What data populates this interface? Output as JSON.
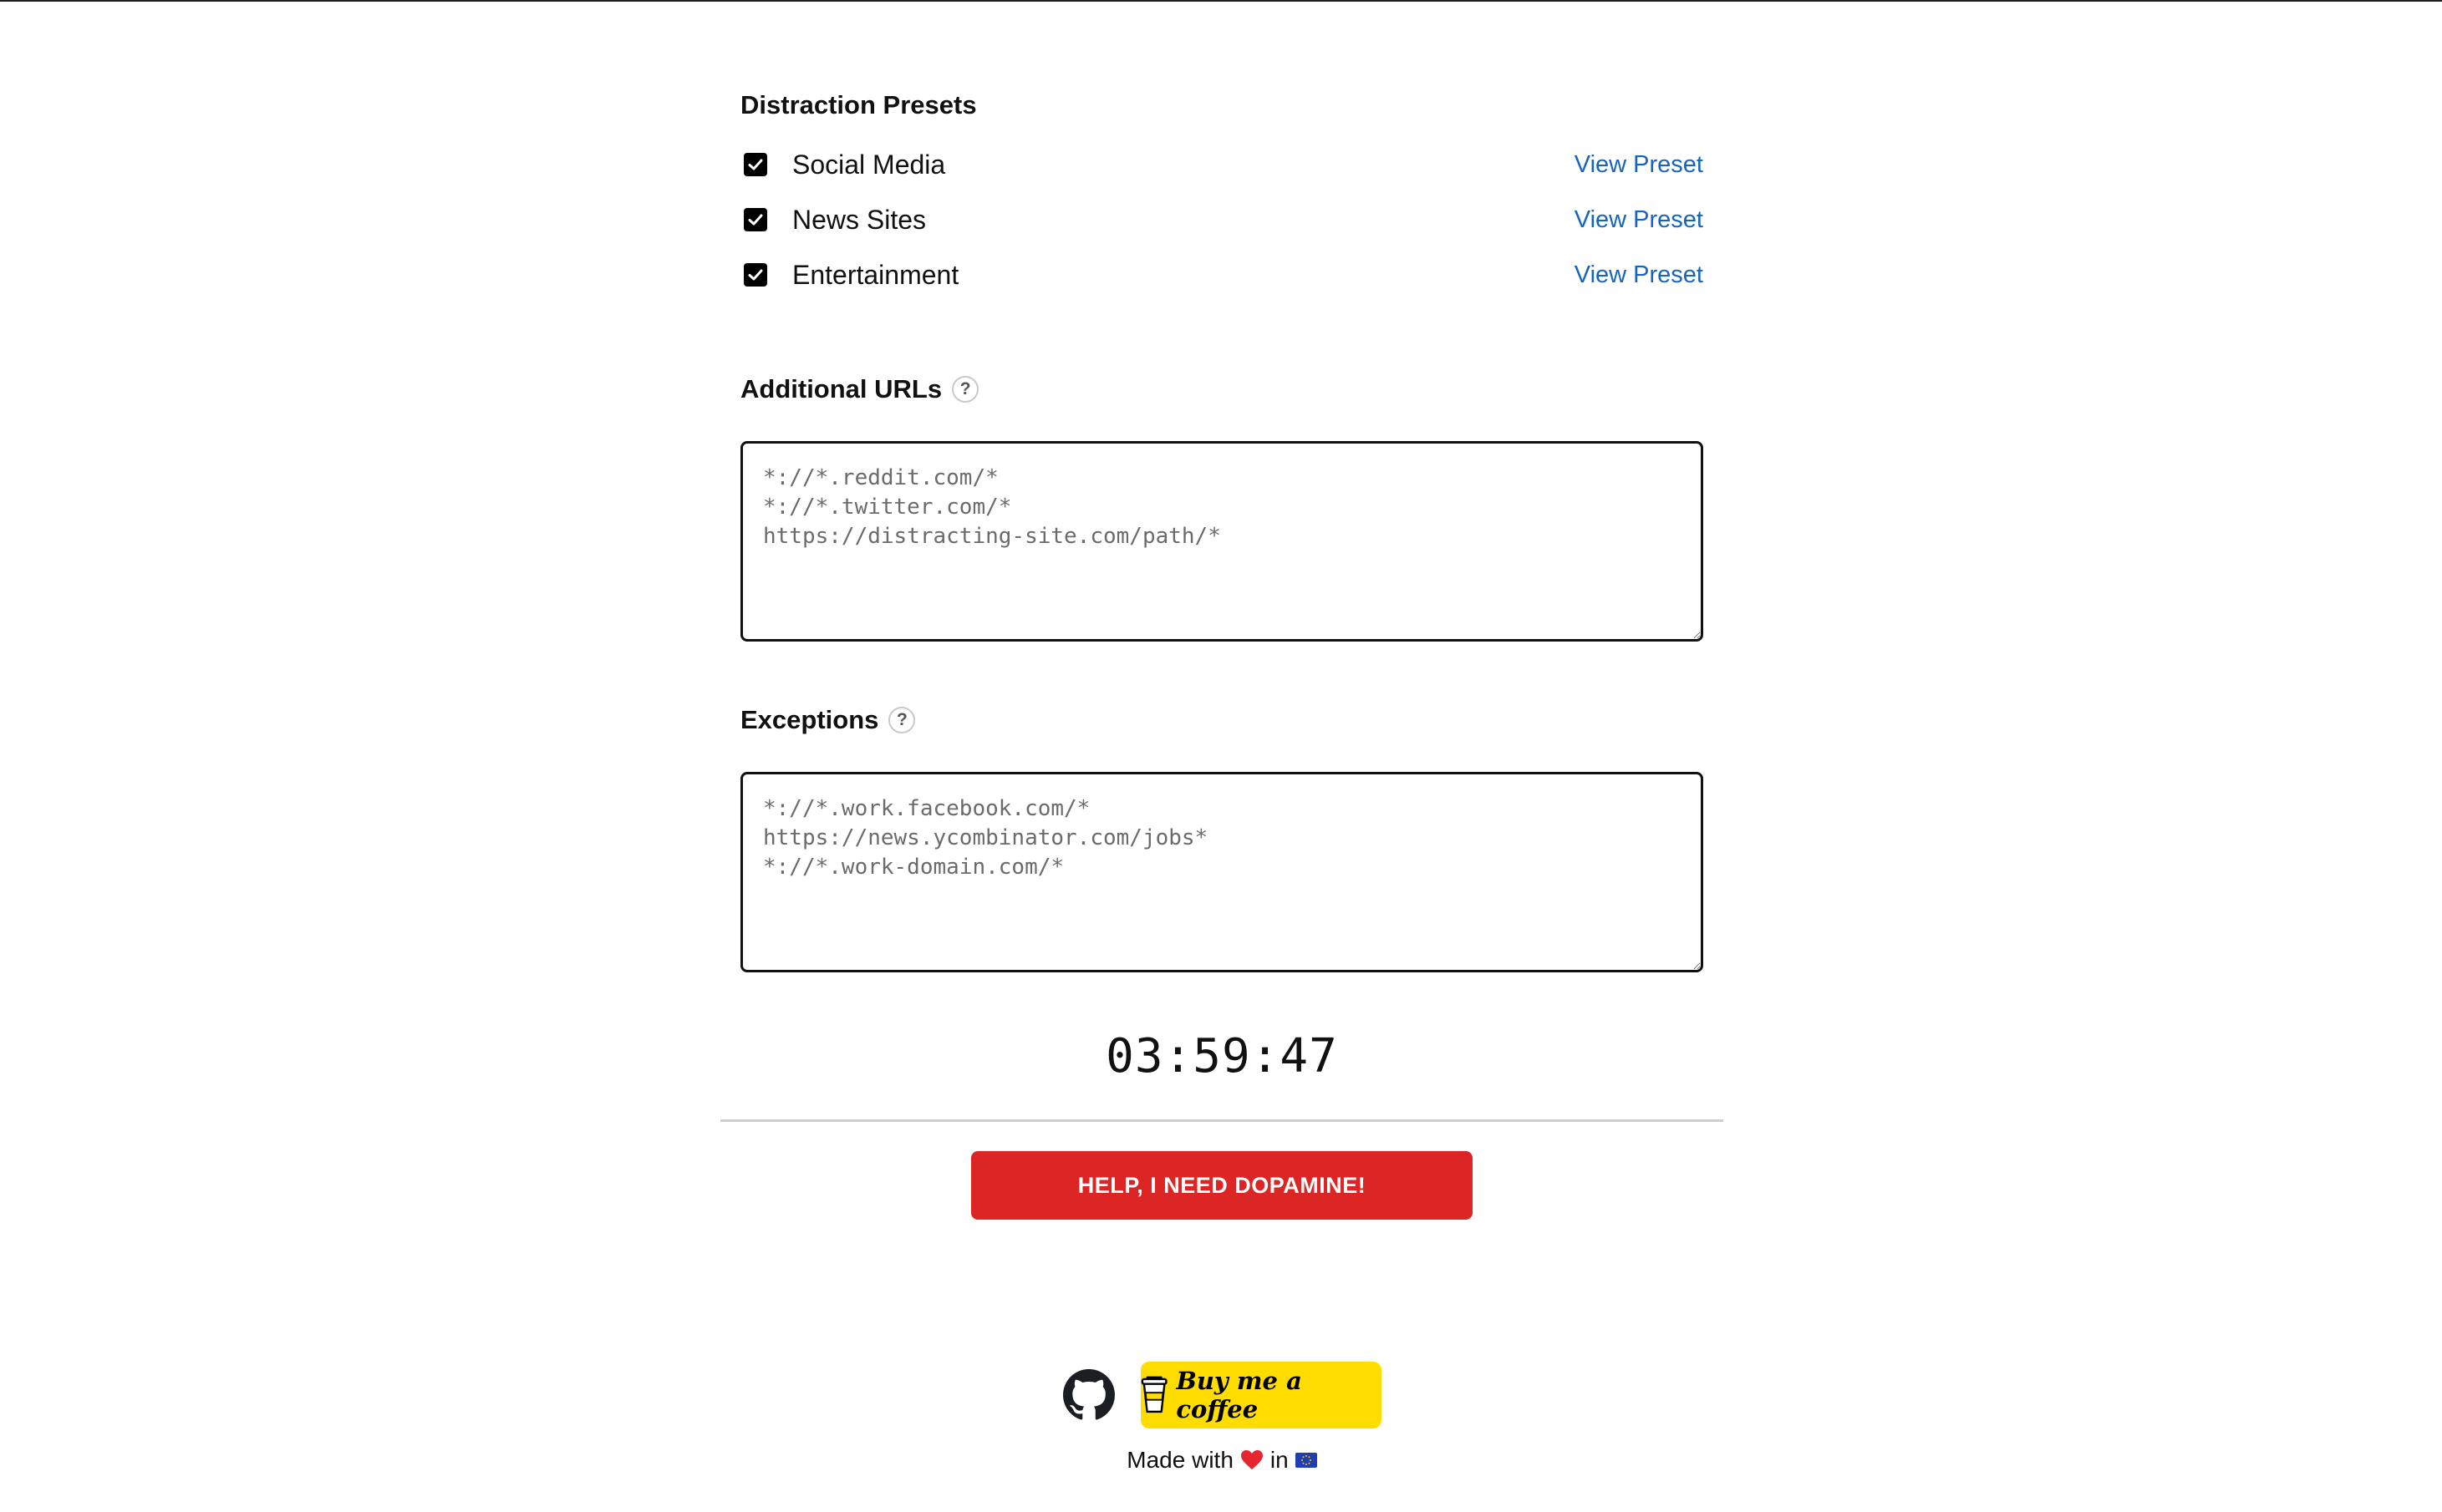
{
  "presets": {
    "title": "Distraction Presets",
    "items": [
      {
        "label": "Social Media",
        "checked": true,
        "link": "View Preset"
      },
      {
        "label": "News Sites",
        "checked": true,
        "link": "View Preset"
      },
      {
        "label": "Entertainment",
        "checked": true,
        "link": "View Preset"
      }
    ]
  },
  "additional_urls": {
    "title": "Additional URLs",
    "help": "?",
    "placeholder": "*://*.reddit.com/*\n*://*.twitter.com/*\nhttps://distracting-site.com/path/*"
  },
  "exceptions": {
    "title": "Exceptions",
    "help": "?",
    "placeholder": "*://*.work.facebook.com/*\nhttps://news.ycombinator.com/jobs*\n*://*.work-domain.com/*"
  },
  "timer": "03:59:47",
  "dopamine_button": "HELP, I NEED DOPAMINE!",
  "footer": {
    "coffee_label": "Buy me a coffee",
    "made_with_prefix": "Made with",
    "made_with_in": "in",
    "icons": [
      "github-icon",
      "coffee-cup-icon",
      "heart-icon",
      "eu-flag-icon"
    ]
  },
  "colors": {
    "accent_link": "#1565c0",
    "danger_button": "#dc2626",
    "coffee_button": "#ffdd00"
  }
}
